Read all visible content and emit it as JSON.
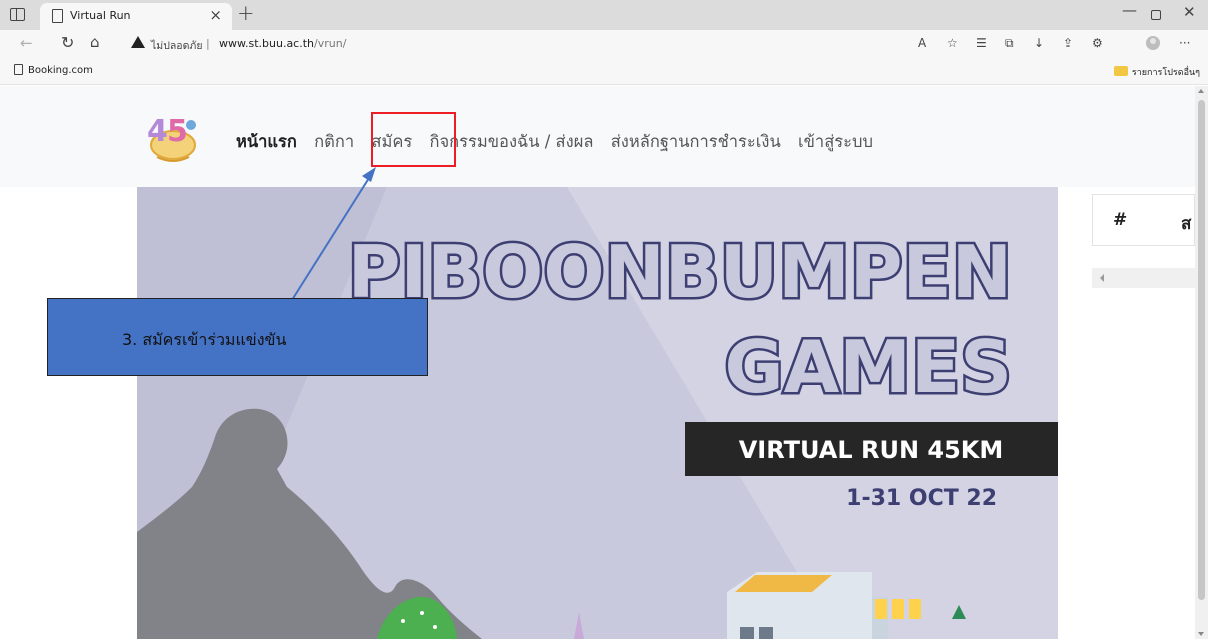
{
  "browser": {
    "tab_title": "Virtual Run",
    "tab_close": "×",
    "new_tab": "+",
    "window_min": "—",
    "window_close": "✕",
    "security_label": "ไม่ปลอดภัย",
    "separator": "|",
    "url_host": "www.st.buu.ac.th",
    "url_path": "/vrun/",
    "more": "···",
    "favorites": [
      {
        "label": "Booking.com"
      }
    ],
    "other_favorites": "รายการโปรดอื่นๆ"
  },
  "nav": {
    "items": [
      {
        "label": "หน้าแรก"
      },
      {
        "label": "กติกา"
      },
      {
        "label": "สมัคร"
      },
      {
        "label": "กิจกรรมของฉัน / ส่งผล"
      },
      {
        "label": "ส่งหลักฐานการชำระเงิน"
      },
      {
        "label": "เข้าสู่ระบบ"
      }
    ],
    "active_index": 0
  },
  "banner": {
    "line1": "PIBOONBUMPEN",
    "line2": "GAMES",
    "subtitle": "VIRTUAL RUN 45KM",
    "dates": "1-31 OCT 22"
  },
  "side_table": {
    "col_hash": "#",
    "col_partial": "ส"
  },
  "annotation": {
    "callout_text": "3. สมัครเข้าร่วมแข่งขัน"
  },
  "colors": {
    "banner_bg": "#c8c9dc",
    "banner_text": "#3d3f73",
    "callout_bg": "#4472c4",
    "highlight": "#ee1c24"
  }
}
